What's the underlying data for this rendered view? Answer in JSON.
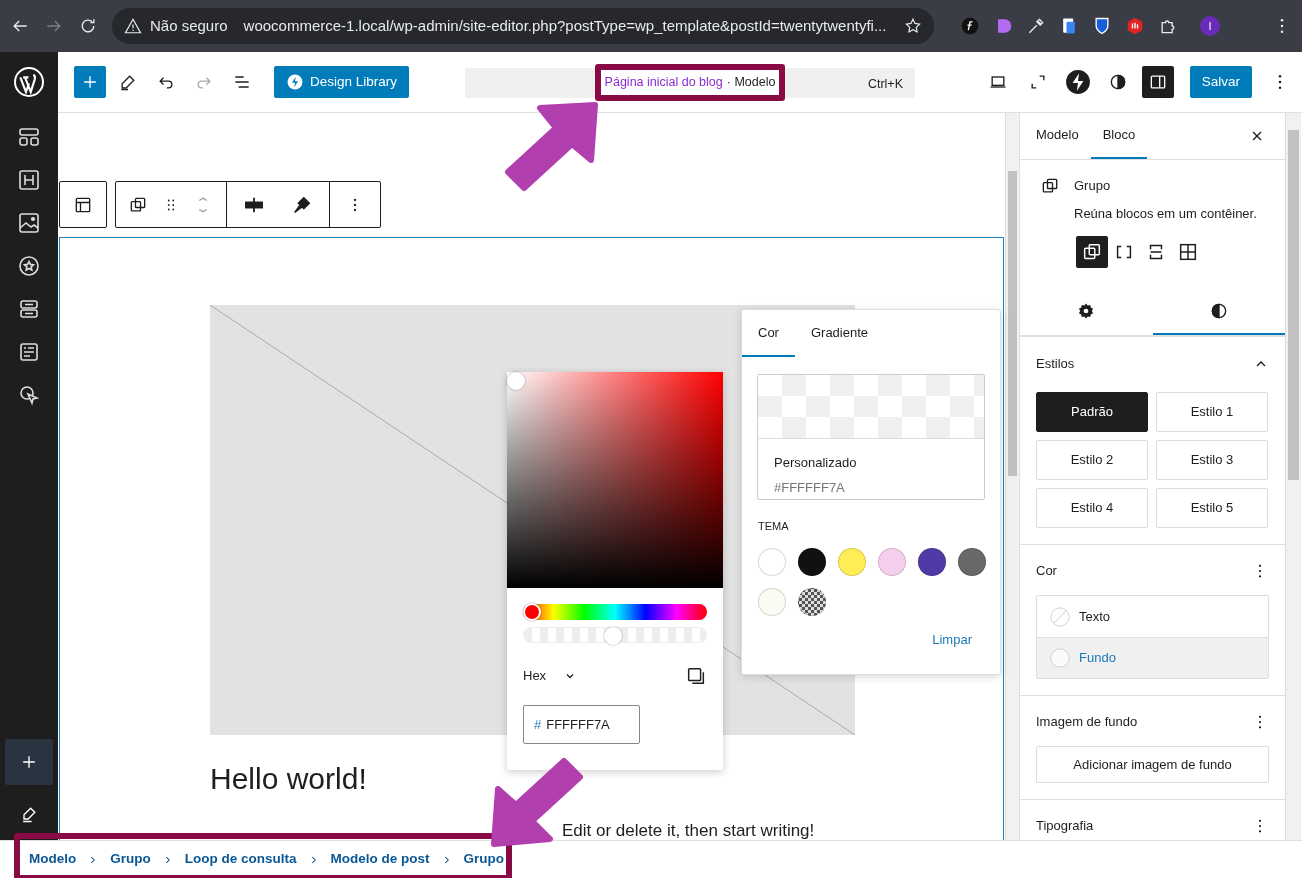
{
  "browser": {
    "security": "Não seguro",
    "url": "woocommerce-1.local/wp-admin/site-editor.php?postType=wp_template&postId=twentytwentyfi...",
    "profile_initial": "I"
  },
  "header": {
    "design_library": "Design Library",
    "command": {
      "title": "Página inicial do blog",
      "type": "· Modelo",
      "shortcut": "Ctrl+K"
    },
    "sidebar_open": true,
    "save": "Salvar"
  },
  "canvas": {
    "heading": "Hello world!",
    "paragraph": "Edit or delete it, then start writing!"
  },
  "color_picker": {
    "hue": {
      "level": 0
    },
    "alpha": {
      "level": 0.48
    },
    "format": "Hex",
    "hash": "#",
    "value": "FFFFFF7A"
  },
  "color_popover": {
    "tabs": [
      {
        "label": "Cor",
        "selected": true
      },
      {
        "label": "Gradiente",
        "selected": false
      }
    ],
    "custom": {
      "label": "Personalizado",
      "value": "#FFFFFF7A"
    },
    "section": "TEMA",
    "swatches": [
      {
        "kind": "solid",
        "color": "#ffffff"
      },
      {
        "kind": "solid",
        "color": "#111111"
      },
      {
        "kind": "solid",
        "color": "#ffee58"
      },
      {
        "kind": "solid",
        "color": "#f6cfef"
      },
      {
        "kind": "solid",
        "color": "#503aa8"
      },
      {
        "kind": "solid",
        "color": "#686868"
      },
      {
        "kind": "solid",
        "color": "#fbfaf3"
      },
      {
        "kind": "pattern"
      }
    ],
    "clear": "Limpar"
  },
  "inspector": {
    "tabs": [
      {
        "label": "Modelo",
        "selected": false
      },
      {
        "label": "Bloco",
        "selected": true
      }
    ],
    "block": {
      "name": "Grupo",
      "description": "Reúna blocos em um contêiner."
    },
    "variations": [
      {
        "kind": "group",
        "selected": true
      },
      {
        "kind": "row",
        "selected": false
      },
      {
        "kind": "stack",
        "selected": false
      },
      {
        "kind": "grid",
        "selected": false
      }
    ],
    "settings_tabs": [
      {
        "kind": "settings",
        "selected": false
      },
      {
        "kind": "styles",
        "selected": true
      }
    ],
    "styles_panel": {
      "title": "Estilos",
      "expanded": true,
      "options": [
        {
          "label": "Padrão",
          "selected": true
        },
        {
          "label": "Estilo 1",
          "selected": false
        },
        {
          "label": "Estilo 2",
          "selected": false
        },
        {
          "label": "Estilo 3",
          "selected": false
        },
        {
          "label": "Estilo 4",
          "selected": false
        },
        {
          "label": "Estilo 5",
          "selected": false
        }
      ]
    },
    "color_panel": {
      "title": "Cor",
      "items": [
        {
          "label": "Texto",
          "kind": "none",
          "selected": false
        },
        {
          "label": "Fundo",
          "kind": "swatch",
          "selected": true
        }
      ]
    },
    "background_panel": {
      "title": "Imagem de fundo",
      "button": "Adicionar imagem de fundo"
    },
    "typography_panel": {
      "title": "Tipografia"
    }
  },
  "breadcrumbs": [
    "Modelo",
    "Grupo",
    "Loop de consulta",
    "Modelo de post",
    "Grupo"
  ]
}
